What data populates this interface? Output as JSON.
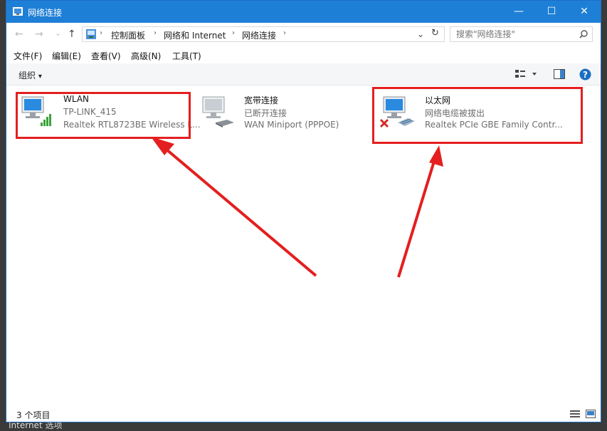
{
  "window": {
    "title": "网络连接"
  },
  "nav": {
    "back": "←",
    "forward": "→",
    "recent": "⌄",
    "up": "↑"
  },
  "address": {
    "crumbs": [
      "控制面板",
      "网络和 Internet",
      "网络连接"
    ],
    "separator": "›",
    "dropdown": "⌄",
    "refresh": "↻"
  },
  "search": {
    "placeholder": "搜索\"网络连接\""
  },
  "menu": [
    "文件(F)",
    "编辑(E)",
    "查看(V)",
    "高级(N)",
    "工具(T)"
  ],
  "command": {
    "organize": "组织",
    "organize_arrow": "▾"
  },
  "connections": [
    {
      "name": "WLAN",
      "status": "TP-LINK_415",
      "device": "Realtek RTL8723BE Wireless L..."
    },
    {
      "name": "宽带连接",
      "status": "已断开连接",
      "device": "WAN Miniport (PPPOE)"
    },
    {
      "name": "以太网",
      "status": "网络电缆被拔出",
      "device": "Realtek PCIe GBE Family Contr..."
    }
  ],
  "statusbar": {
    "count": "3 个项目"
  },
  "background": {
    "bottom_text": "Internet 选项"
  },
  "colors": {
    "accent": "#1e7fd6",
    "highlight": "#e41f1f"
  }
}
